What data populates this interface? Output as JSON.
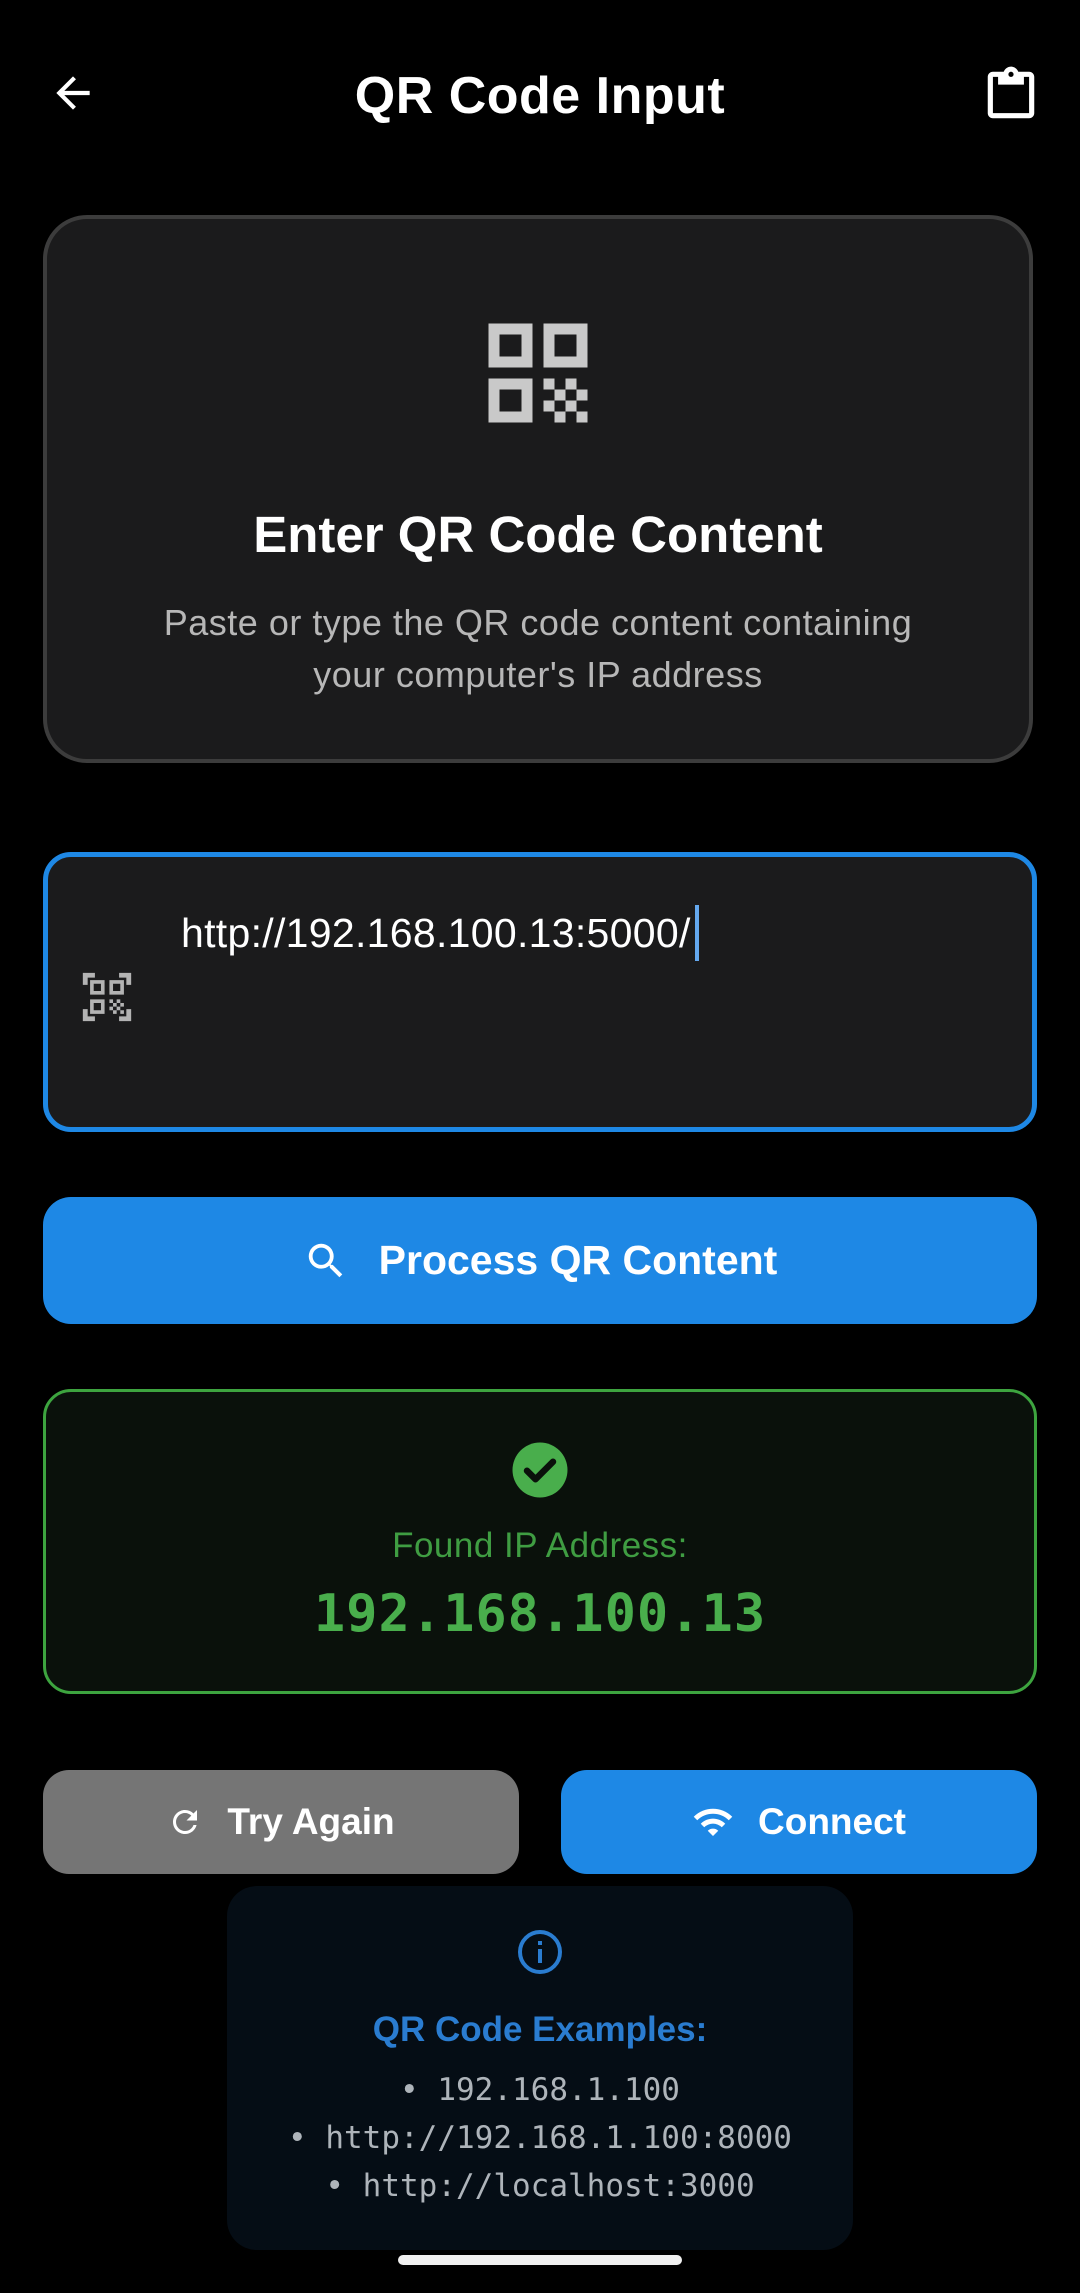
{
  "appbar": {
    "title": "QR Code Input",
    "back_icon": "arrow-left-icon",
    "clipboard_icon": "clipboard-icon"
  },
  "header_card": {
    "icon": "qr-code-icon",
    "title": "Enter QR Code Content",
    "description": "Paste or type the QR code content containing your computer's IP address"
  },
  "input": {
    "value": "http://192.168.100.13:5000/",
    "prefix_icon": "qr-code-scanner-icon",
    "focused": true
  },
  "process_button": {
    "label": "Process QR Content",
    "icon": "search-icon"
  },
  "result": {
    "icon": "check-circle-icon",
    "label": "Found IP Address:",
    "ip": "192.168.100.13"
  },
  "actions": {
    "try_again": {
      "label": "Try Again",
      "icon": "refresh-icon"
    },
    "connect": {
      "label": "Connect",
      "icon": "wifi-icon"
    }
  },
  "examples": {
    "icon": "info-icon",
    "title": "QR Code Examples:",
    "items": [
      "• 192.168.1.100",
      "• http://192.168.1.100:8000",
      "• http://localhost:3000"
    ]
  },
  "colors": {
    "background": "#000000",
    "card": "#1b1b1c",
    "accent": "#1e88e5",
    "success": "#49ae4c",
    "neutral_button": "#757575",
    "info": "#2a7cd0"
  }
}
